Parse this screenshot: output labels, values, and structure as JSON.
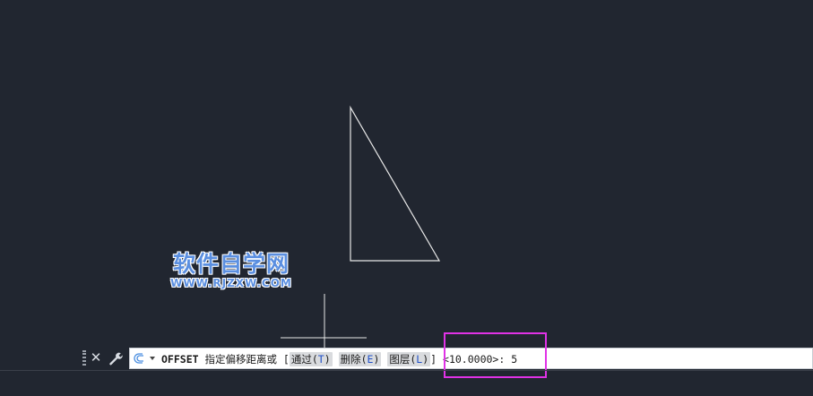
{
  "watermark": {
    "chinese_text": "软件自学网",
    "url_text": "WWW.RJZXW.COM"
  },
  "command_line": {
    "command": "OFFSET",
    "prompt": "指定偏移距离或 [",
    "options": [
      {
        "label": "通过(",
        "key": "T",
        "suffix": ")"
      },
      {
        "label": "删除(",
        "key": "E",
        "suffix": ")"
      },
      {
        "label": "图层(",
        "key": "L",
        "suffix": ")"
      }
    ],
    "prompt_close": "]",
    "default_value": "<10.0000>:",
    "input_value": "5"
  },
  "colors": {
    "canvas_background": "#212630",
    "drawing_lines": "#ffffff",
    "highlight_box": "#e032e6",
    "option_key": "#2050c8"
  },
  "icons": {
    "close": "close-icon",
    "customize": "wrench-icon",
    "command_history": "offset-command-icon"
  }
}
